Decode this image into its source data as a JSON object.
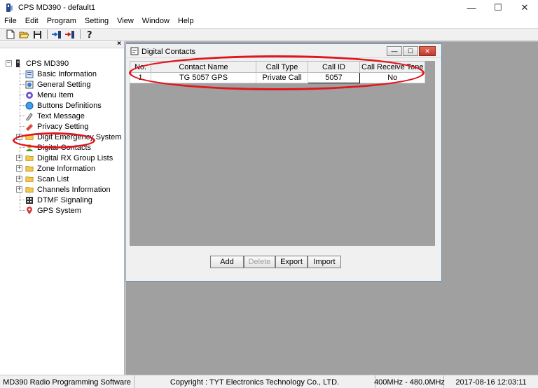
{
  "window": {
    "title": "CPS MD390 - default1"
  },
  "window_controls": {
    "minimize": "—",
    "maximize": "☐",
    "close": "✕"
  },
  "menu": [
    "File",
    "Edit",
    "Program",
    "Setting",
    "View",
    "Window",
    "Help"
  ],
  "toolbar": {
    "icons": [
      "new-file-icon",
      "open-folder-icon",
      "save-icon",
      "read-radio-icon",
      "write-radio-icon",
      "help-icon"
    ]
  },
  "tree": {
    "root": "CPS MD390",
    "close_symbol": "×",
    "items": [
      {
        "label": "Basic Information",
        "icon": "info-icon",
        "expandable": false
      },
      {
        "label": "General Setting",
        "icon": "general-setting-icon",
        "expandable": false
      },
      {
        "label": "Menu Item",
        "icon": "menu-item-icon",
        "expandable": false
      },
      {
        "label": "Buttons Definitions",
        "icon": "button-definition-icon",
        "expandable": false
      },
      {
        "label": "Text Message",
        "icon": "text-message-icon",
        "expandable": false
      },
      {
        "label": "Privacy Setting",
        "icon": "privacy-icon",
        "expandable": false
      },
      {
        "label": "Digit Emergency System",
        "icon": "folder-icon",
        "expandable": true
      },
      {
        "label": "Digital Contacts",
        "icon": "contacts-icon",
        "expandable": false
      },
      {
        "label": "Digital RX Group Lists",
        "icon": "folder-icon",
        "expandable": true
      },
      {
        "label": "Zone Information",
        "icon": "folder-icon",
        "expandable": true
      },
      {
        "label": "Scan List",
        "icon": "folder-icon",
        "expandable": true
      },
      {
        "label": "Channels Information",
        "icon": "folder-icon",
        "expandable": true
      },
      {
        "label": "DTMF Signaling",
        "icon": "dtmf-icon",
        "expandable": false
      },
      {
        "label": "GPS System",
        "icon": "gps-icon",
        "expandable": false
      }
    ]
  },
  "child_window": {
    "title": "Digital Contacts",
    "columns": [
      "No.",
      "Contact Name",
      "Call Type",
      "Call ID",
      "Call Receive Tone"
    ],
    "rows": [
      {
        "no": "1",
        "name": "TG 5057 GPS",
        "type": "Private Call",
        "id": "5057",
        "tone": "No"
      }
    ],
    "buttons": {
      "add": "Add",
      "delete": "Delete",
      "export": "Export",
      "import": "Import"
    }
  },
  "status": {
    "software": "MD390 Radio Programming Software",
    "copyright": "Copyright : TYT Electronics Technology Co., LTD.",
    "frequency": "400MHz - 480.0MHz",
    "datetime": "2017-08-16 12:03:11"
  },
  "colors": {
    "annotation": "#e0171e",
    "mdi_background": "#a0a0a0",
    "folder": "#f5c84c"
  }
}
